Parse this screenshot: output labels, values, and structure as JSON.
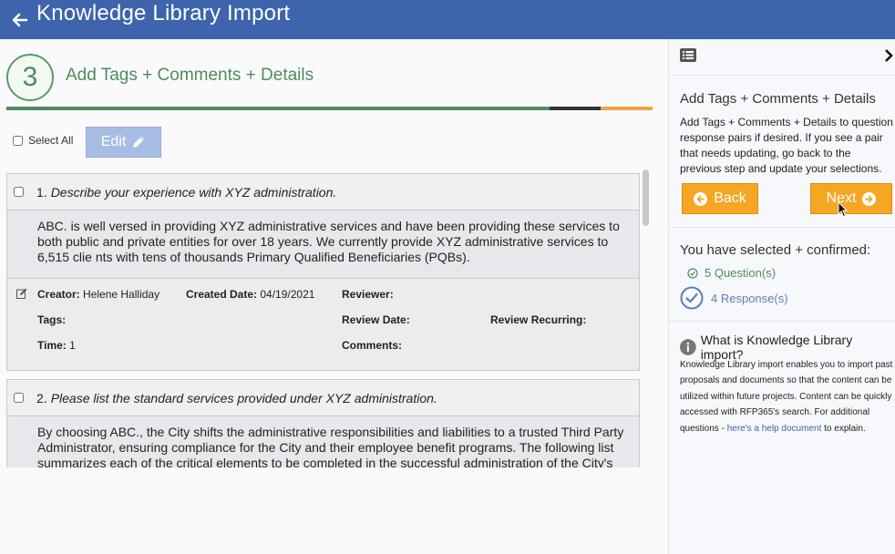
{
  "header": {
    "title": "Knowledge Library Import",
    "bar_color": "#3d64ad"
  },
  "step": {
    "number": "3",
    "title": "Add Tags + Comments + Details"
  },
  "toolbar": {
    "select_all_label": "Select All",
    "edit_label": "Edit"
  },
  "items": [
    {
      "num": "1.",
      "question": "Describe your experience with XYZ administration.",
      "answer": "ABC. is well versed in providing XYZ administrative services and have been providing these services to both public and private entities for over 18 years. We currently provide XYZ administrative services to 6,515 clie nts with tens of thousands Primary Qualified Beneficiaries (PQBs).",
      "meta": {
        "creator_label": "Creator:",
        "creator": "Helene Halliday",
        "created_date_label": "Created Date:",
        "created_date": "04/19/2021",
        "reviewer_label": "Reviewer:",
        "tags_label": "Tags:",
        "review_date_label": "Review Date:",
        "review_recurring_label": "Review Recurring:",
        "time_label": "Time:",
        "time": "1",
        "comments_label": "Comments:"
      }
    },
    {
      "num": "2.",
      "question": "Please list the standard services provided under XYZ administration.",
      "answer": "By choosing ABC., the City shifts the administrative responsibilities and liabilities to a trusted Third Party Administrator, ensuring compliance for the City and their employee benefit programs. The following list summarizes each of the critical elements to be completed in the successful administration of the City's"
    }
  ],
  "sidebar": {
    "title": "Add Tags + Comments + Details",
    "description": "Add Tags + Comments + Details to question response pairs if desired. If you see a pair that needs updating, go back to the previous step and update your selections.",
    "back_label": "Back",
    "next_label": "Next",
    "selected_title": "You have selected + confirmed:",
    "questions_count": "5 Question(s)",
    "responses_count": "4 Response(s)",
    "what_title": "What is Knowledge Library import?",
    "what_desc_pre": "Knowledge Library import enables you to import past proposals and documents so that the content can be utilized within future projects. Content can be quickly accessed with RFP365's search. For additional questions - ",
    "what_link": "here's a help document",
    "what_desc_post": " to explain."
  },
  "colors": {
    "accent_green": "#4d8c5d",
    "button_orange": "#f5a623",
    "link_blue": "#3d64ad"
  }
}
